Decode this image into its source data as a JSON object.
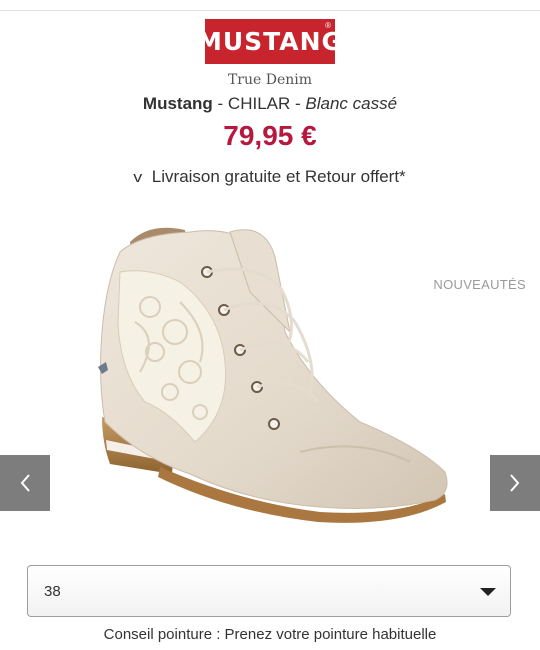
{
  "brand_logo": {
    "text": "MUSTANG",
    "registered": "®",
    "tagline": "True Denim",
    "color": "#c8242e"
  },
  "product": {
    "brand": "Mustang",
    "separator1": " - ",
    "model": "CHILAR",
    "separator2": " - ",
    "color": "Blanc cassé",
    "price": "79,95 €",
    "price_color": "#b7183e"
  },
  "delivery": {
    "icon": "check-icon",
    "check_glyph": "v",
    "text": "Livraison gratuite et Retour offert*"
  },
  "gallery": {
    "badge": "NOUVEAUTÉS",
    "prev_icon": "chevron-left-icon",
    "next_icon": "chevron-right-icon"
  },
  "size_selector": {
    "selected_value": "38",
    "icon": "dropdown-arrow-icon"
  },
  "size_advice": "Conseil pointure : Prenez votre pointure habituelle"
}
